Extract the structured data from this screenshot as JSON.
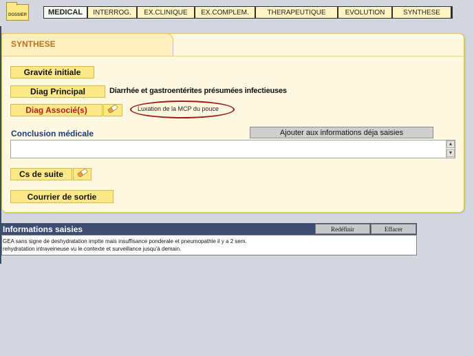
{
  "nav": {
    "dossier_label": "DOSSIER",
    "tabs": [
      {
        "label": "MEDICAL",
        "active": true
      },
      {
        "label": "INTERROG.",
        "active": false
      },
      {
        "label": "EX.CLINIQUE",
        "active": false
      },
      {
        "label": "EX.COMPLEM.",
        "active": false
      },
      {
        "label": "THERAPEUTIQUE",
        "active": false
      },
      {
        "label": "EVOLUTION",
        "active": false
      },
      {
        "label": "SYNTHESE",
        "active": false
      }
    ]
  },
  "synthese": {
    "title": "SYNTHESE",
    "gravite_label": "Gravité initiale",
    "diag_principal_label": "Diag Principal",
    "diag_principal_value": "Diarrhée et gastroentérites présumées infectieuses",
    "diag_associe_label": "Diag Associé(s)",
    "diag_associe_value": "Luxation de la MCP du pouce",
    "conclusion_label": "Conclusion médicale",
    "conclusion_value": "",
    "ajouter_label": "Ajouter aux informations déja saisies",
    "cs_suite_label": "Cs de suite",
    "courrier_label": "Courrier de sortie"
  },
  "informations": {
    "title": "Informations saisies",
    "redefinir_label": "Redéfinir",
    "effacer_label": "Effacer",
    "lines": [
      "GEA sans signe de deshydratation imptte mais insuffisance ponderale et pneumopathie il y a 2 sem.",
      "rehydratation intraveineuse vu le contexte et surveillance jusqu'à demain."
    ]
  },
  "colors": {
    "accent_yellow": "#fde98a",
    "header_blue": "#3d4c70",
    "title_orange": "#c07020",
    "alert_red": "#b81e1e"
  }
}
